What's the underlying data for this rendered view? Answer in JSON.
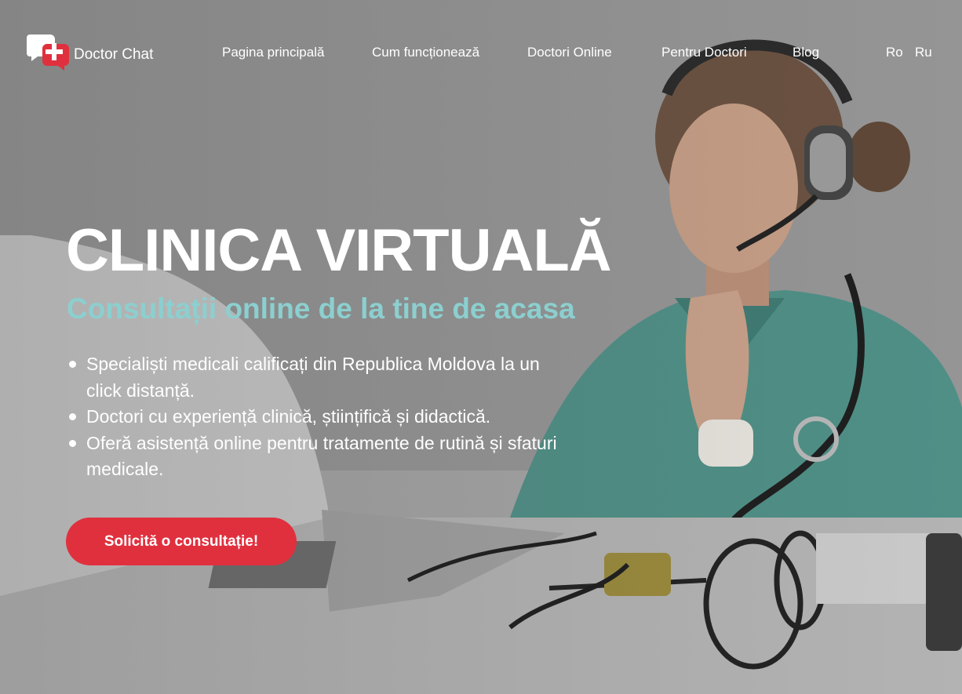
{
  "brand": {
    "name": "Doctor Chat",
    "accent": "#e0303e",
    "teal": "#8ccfcf"
  },
  "nav": {
    "items": [
      {
        "label": "Pagina principală"
      },
      {
        "label": "Cum funcționează"
      },
      {
        "label": "Doctori Online"
      },
      {
        "label": "Pentru Doctori"
      },
      {
        "label": "Blog"
      }
    ]
  },
  "languages": [
    "Ro",
    "Ru"
  ],
  "hero": {
    "title": "CLINICA VIRTUALĂ",
    "subtitle": "Consultații online de la tine de acasa",
    "bullets": [
      "Specialiști medicali calificați din Republica Moldova la un click distanță.",
      "Doctori cu experiență clinică, științifică și didactică.",
      "Oferă asistență online pentru tratamente de rutină și sfaturi medicale."
    ],
    "cta_label": "Solicită o consultație!"
  },
  "icons": {
    "logo": "chat-cross-logo-icon"
  }
}
